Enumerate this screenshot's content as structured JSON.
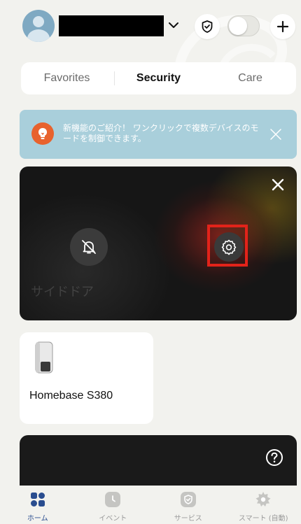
{
  "header": {
    "user_name_redacted": "",
    "mode_toggle": "off"
  },
  "tabs": [
    {
      "label": "Favorites",
      "active": false
    },
    {
      "label": "Security",
      "active": true
    },
    {
      "label": "Care",
      "active": false
    }
  ],
  "banner": {
    "text": "新機能のご紹介！ ワンクリックで複数デバイスのモードを制御できます。",
    "icon": "lightbulb-icon"
  },
  "camera": {
    "name": "サイドドア",
    "status": "",
    "timestamp": "",
    "controls": [
      "bell-off-icon",
      "gear-icon"
    ]
  },
  "devices": [
    {
      "name": "Homebase S380",
      "icon": "homebase-icon"
    }
  ],
  "bottom_nav": [
    {
      "label": "ホーム",
      "icon": "grid-icon",
      "active": true
    },
    {
      "label": "イベント",
      "icon": "clock-icon",
      "active": false
    },
    {
      "label": "サービス",
      "icon": "shield-icon",
      "active": false
    },
    {
      "label": "スマート (自動)",
      "icon": "sparkle-gear-icon",
      "active": false
    }
  ],
  "colors": {
    "background": "#f2f2ee",
    "banner": "#a9cfdb",
    "accent_orange": "#e8622d",
    "highlight_red": "#e2231a",
    "nav_active": "#2a4d8f"
  }
}
